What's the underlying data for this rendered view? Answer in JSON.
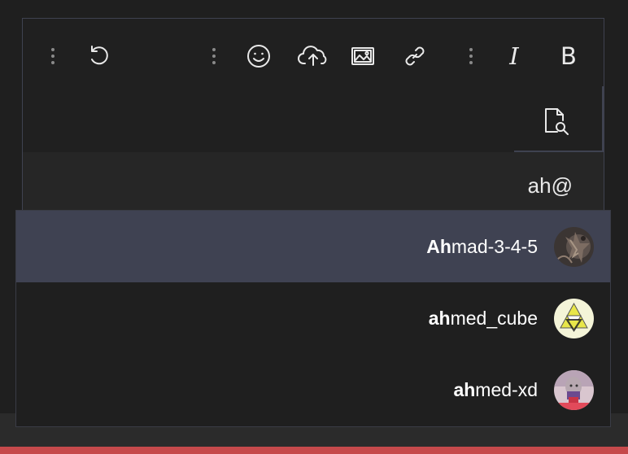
{
  "toolbar": {
    "buttons": [
      {
        "name": "undo",
        "icon": "undo-icon"
      },
      {
        "name": "emoji",
        "icon": "smiley-icon"
      },
      {
        "name": "upload",
        "icon": "cloud-upload-icon"
      },
      {
        "name": "image",
        "icon": "image-icon"
      },
      {
        "name": "link",
        "icon": "link-icon"
      },
      {
        "name": "italic",
        "label": "I"
      },
      {
        "name": "bold",
        "label": "B"
      }
    ],
    "preview_icon": "document-search-icon"
  },
  "editor": {
    "typed_text": "ah@"
  },
  "autocomplete": {
    "items": [
      {
        "match": "Ah",
        "rest": "mad-3-4-5",
        "avatar": "dark-creature-avatar",
        "highlighted": true
      },
      {
        "match": "ah",
        "rest": "med_cube",
        "avatar": "triforce-avatar",
        "highlighted": false
      },
      {
        "match": "ah",
        "rest": "med-xd",
        "avatar": "photo-avatar",
        "highlighted": false
      }
    ]
  },
  "colors": {
    "background": "#1f1f1f",
    "highlight": "#3f4252",
    "border": "#3f4250",
    "accent_bar": "#c6494b",
    "text": "#e9e9e9"
  }
}
